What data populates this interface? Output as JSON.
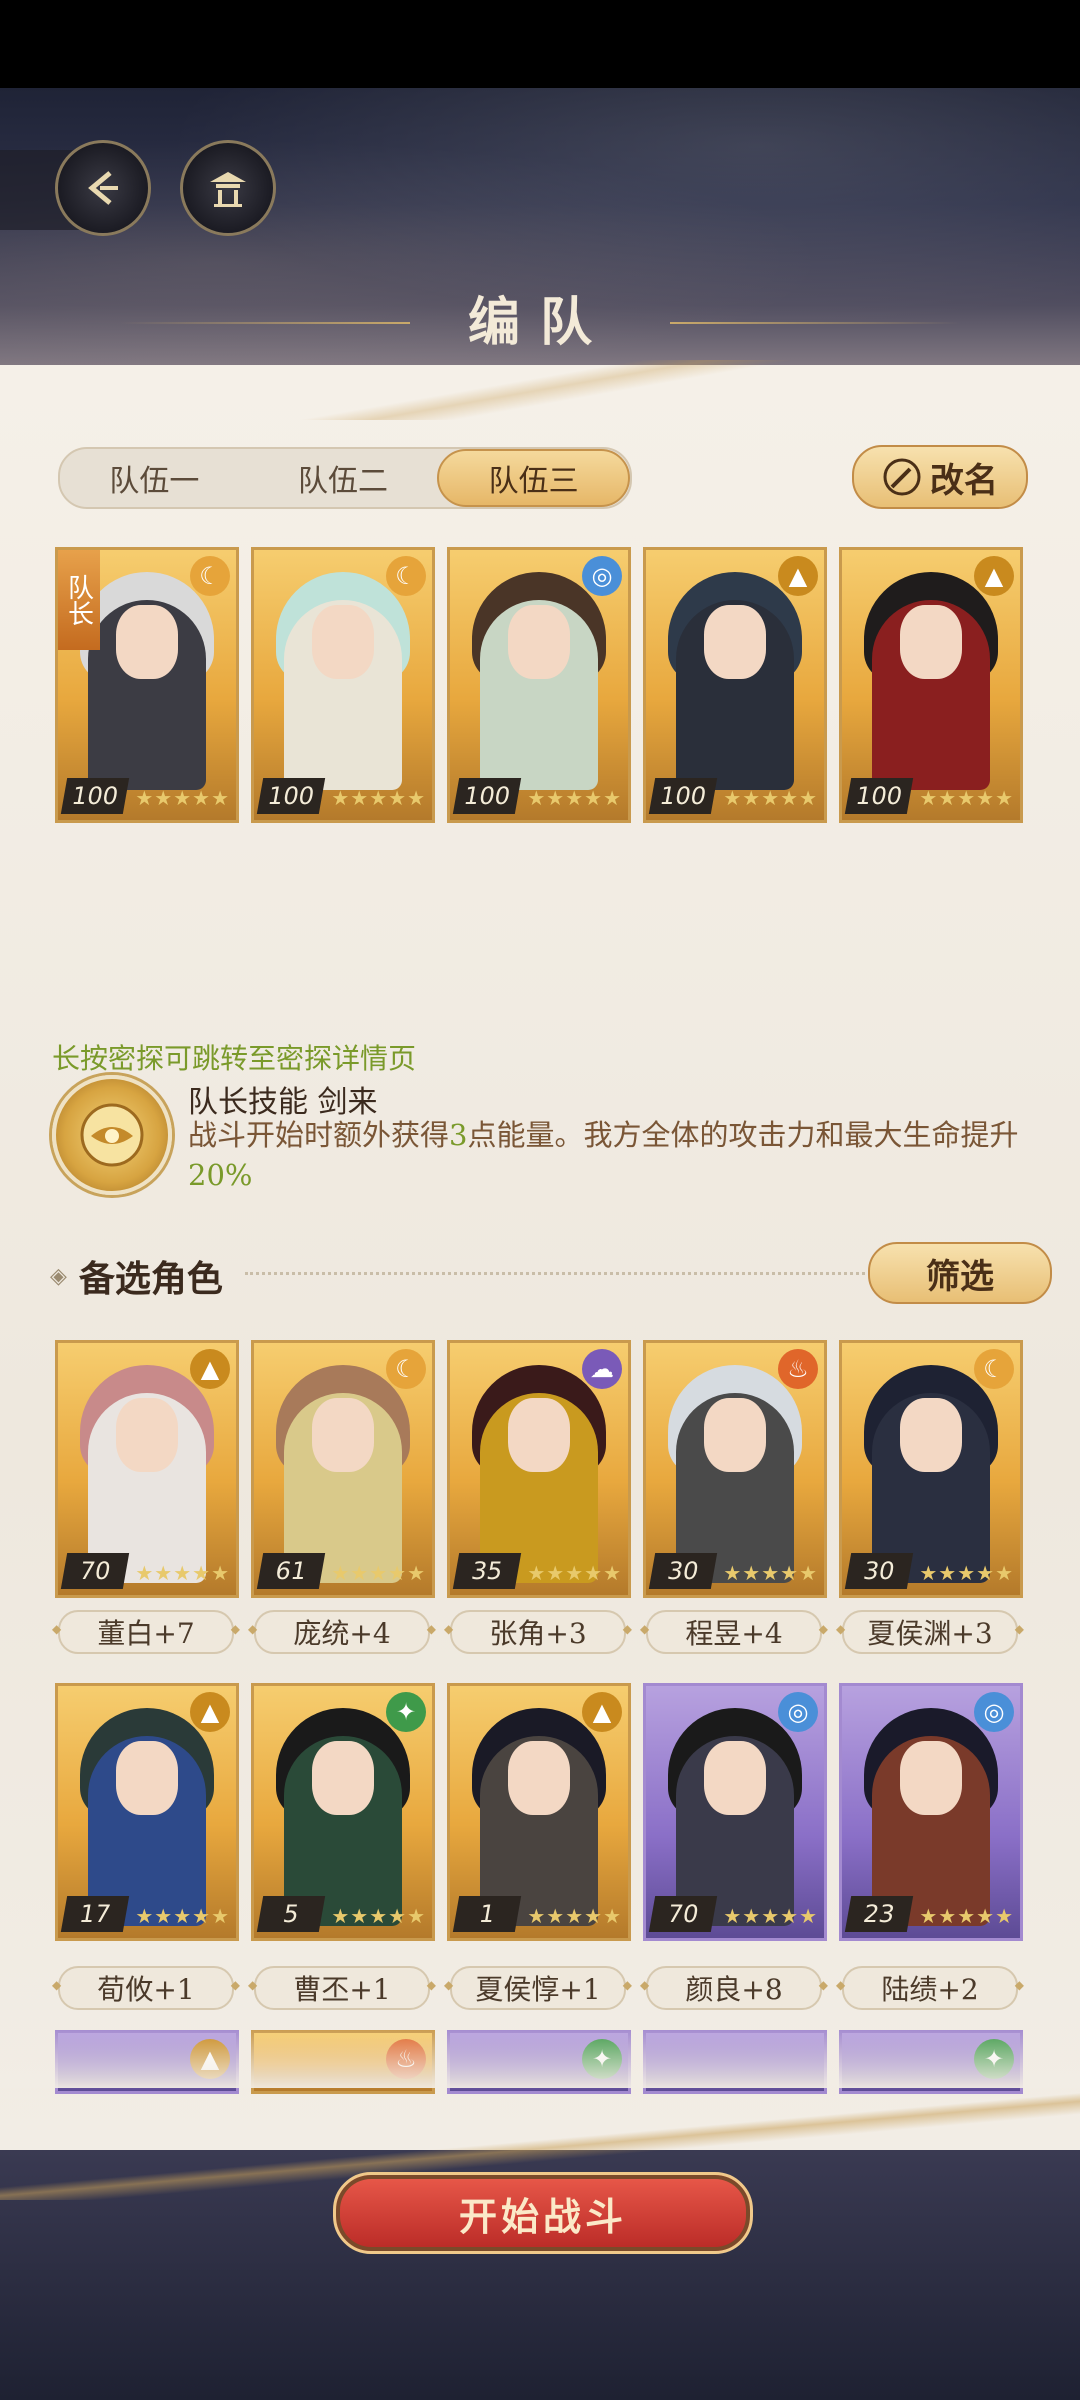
{
  "header": {
    "title": "编队",
    "back_icon": "back-arrow-icon",
    "home_icon": "pavilion-icon"
  },
  "tabs": [
    {
      "label": "队伍一",
      "active": false
    },
    {
      "label": "队伍二",
      "active": false
    },
    {
      "label": "队伍三",
      "active": true
    }
  ],
  "rename_button": {
    "label": "改名",
    "icon": "brush-icon"
  },
  "team": {
    "leader_tag": "队长",
    "members": [
      {
        "level": "100",
        "element": "moon",
        "stars": "★★★★★",
        "is_leader": true,
        "hair": "#d9d9d9",
        "robe": "#3c3c44"
      },
      {
        "level": "100",
        "element": "moon",
        "stars": "★★★★★",
        "is_leader": false,
        "hair": "#bfe2d9",
        "robe": "#e9e4d6"
      },
      {
        "level": "100",
        "element": "wave",
        "stars": "★★★★★",
        "is_leader": false,
        "hair": "#4a3527",
        "robe": "#c8d6c4"
      },
      {
        "level": "100",
        "element": "mountain",
        "stars": "★★★★★",
        "is_leader": false,
        "hair": "#2e3a4a",
        "robe": "#2a2f3a"
      },
      {
        "level": "100",
        "element": "mountain",
        "stars": "★★★★★",
        "is_leader": false,
        "hair": "#1f1c1c",
        "robe": "#8a1f1f"
      }
    ]
  },
  "hint": "长按密探可跳转至密探详情页",
  "leader_skill": {
    "title": "队长技能  剑来",
    "desc_pre": "战斗开始时额外获得",
    "desc_num": "3",
    "desc_mid": "点能量。我方全体的攻击力和最大生命提升",
    "desc_pct": "20%"
  },
  "reserve": {
    "heading": "备选角色",
    "filter_label": "筛选",
    "rows": [
      [
        {
          "level": "70",
          "name": "董白+7",
          "element": "mountain",
          "card": "gold",
          "hair": "#c88a8a",
          "robe": "#e9e4e0"
        },
        {
          "level": "61",
          "name": "庞统+4",
          "element": "moon",
          "card": "gold",
          "hair": "#a87a5a",
          "robe": "#d9c98a"
        },
        {
          "level": "35",
          "name": "张角+3",
          "element": "cloud",
          "card": "gold",
          "hair": "#3a1a1a",
          "robe": "#c99a1f"
        },
        {
          "level": "30",
          "name": "程昱+4",
          "element": "fire",
          "card": "gold",
          "hair": "#d6dbe0",
          "robe": "#4a4a4a"
        },
        {
          "level": "30",
          "name": "夏侯渊+3",
          "element": "moon",
          "card": "gold",
          "hair": "#1e2233",
          "robe": "#2a2f40"
        }
      ],
      [
        {
          "level": "17",
          "name": "荀攸+1",
          "element": "mountain",
          "card": "gold",
          "hair": "#2a3a38",
          "robe": "#2e4a8a"
        },
        {
          "level": "5",
          "name": "曹丕+1",
          "element": "leaf",
          "card": "gold",
          "hair": "#1a1a1a",
          "robe": "#2a4a38"
        },
        {
          "level": "1",
          "name": "夏侯惇+1",
          "element": "mountain",
          "card": "gold",
          "hair": "#1a1a26",
          "robe": "#4a4440"
        },
        {
          "level": "70",
          "name": "颜良+8",
          "element": "wave",
          "card": "purple",
          "hair": "#1a1a1a",
          "robe": "#3a3a4a"
        },
        {
          "level": "23",
          "name": "陆绩+2",
          "element": "wave",
          "card": "purple",
          "hair": "#1a1a2a",
          "robe": "#7a3a2a"
        }
      ]
    ],
    "partial_row_elements": [
      "mountain",
      "fire",
      "leaf",
      "",
      "leaf"
    ]
  },
  "start_button": {
    "label": "开始战斗"
  },
  "element_colors": {
    "moon": "#e6a43a",
    "wave": "#4a8fd8",
    "mountain": "#c98a1e",
    "fire": "#e0662a",
    "leaf": "#3f9a4a",
    "cloud": "#7a5ab8"
  }
}
